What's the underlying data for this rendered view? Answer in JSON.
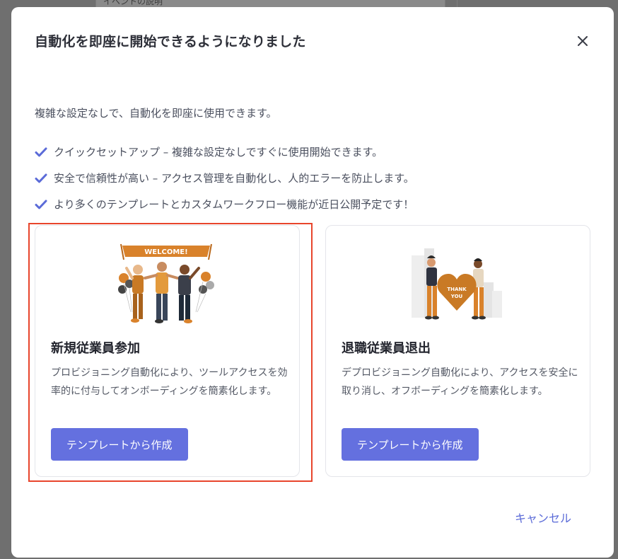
{
  "backdrop": {
    "card_text": "イベントの説明"
  },
  "modal": {
    "title": "自動化を即座に開始できるようになりました",
    "close_icon": "close-icon",
    "intro": "複雑な設定なしで、自動化を即座に使用できます。",
    "features": [
      {
        "icon": "check-icon",
        "text": "クイックセットアップ – 複雑な設定なしですぐに使用開始できます。"
      },
      {
        "icon": "check-icon",
        "text": "安全で信頼性が高い – アクセス管理を自動化し、人的エラーを防止します。"
      },
      {
        "icon": "check-icon",
        "text": "より多くのテンプレートとカスタムワークフロー機能が近日公開予定です！"
      }
    ],
    "cards": [
      {
        "title": "新規従業員参加",
        "description": "プロビジョニング自動化により、ツールアクセスを効率的に付与してオンボーディングを簡素化します。",
        "button": "テンプレートから作成",
        "banner": "WELCOME!"
      },
      {
        "title": "退職従業員退出",
        "description": "デプロビジョニング自動化により、アクセスを安全に取り消し、オフボーディングを簡素化します。",
        "button": "テンプレートから作成",
        "heart_text_1": "THANK",
        "heart_text_2": "YOU"
      }
    ],
    "cancel": "キャンセル"
  },
  "colors": {
    "accent": "#6470df",
    "check": "#5b6bd8",
    "highlight": "#e8452c",
    "illustration_orange": "#d9822b"
  }
}
